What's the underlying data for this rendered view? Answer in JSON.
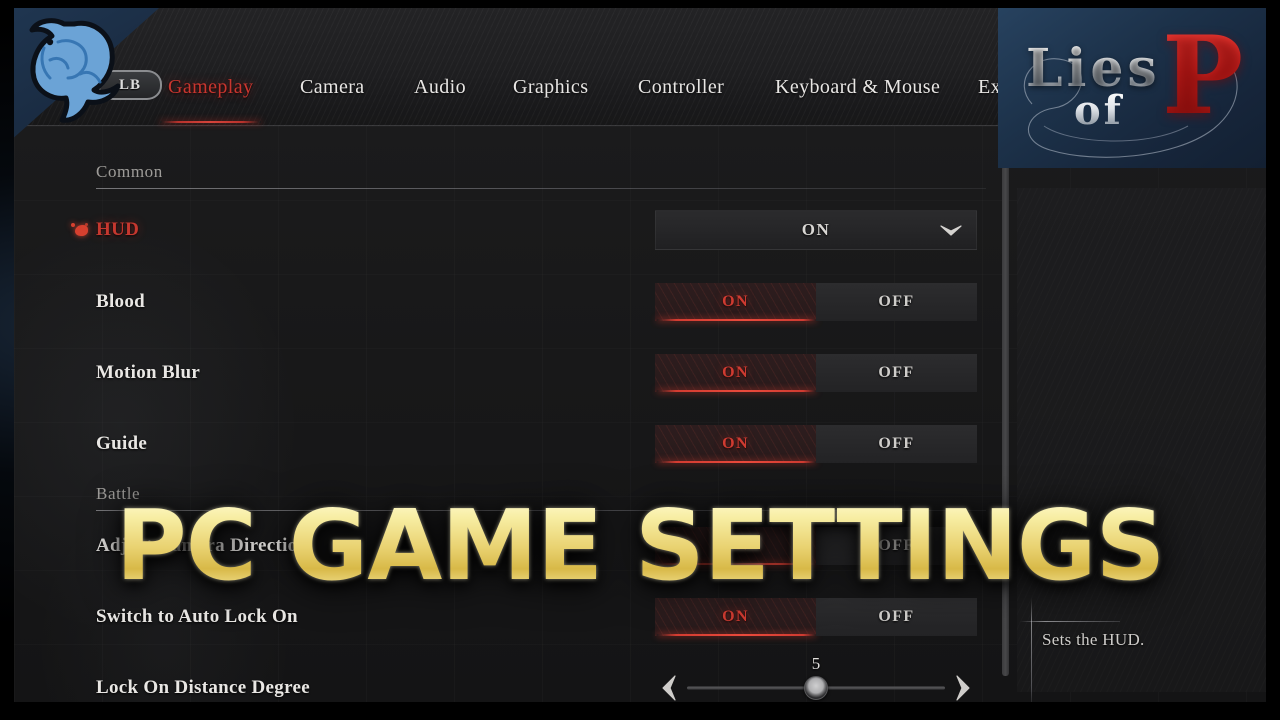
{
  "overlay": {
    "title": "PC GAME SETTINGS",
    "channel_logo": "blue-creature-mascot-logo"
  },
  "game_logo": {
    "line1": "Lies",
    "line2": "of",
    "accent": "P",
    "accent_color": "#d2241e"
  },
  "nav": {
    "bumper_label": "LB",
    "tabs": [
      {
        "label": "Gameplay",
        "active": true
      },
      {
        "label": "Camera",
        "active": false
      },
      {
        "label": "Audio",
        "active": false
      },
      {
        "label": "Graphics",
        "active": false
      },
      {
        "label": "Controller",
        "active": false
      },
      {
        "label": "Keyboard & Mouse",
        "active": false
      },
      {
        "label": "Exit",
        "active": false
      }
    ]
  },
  "sections": [
    {
      "title": "Common"
    },
    {
      "title": "Battle"
    }
  ],
  "rows": [
    {
      "label": "HUD",
      "control": "dropdown",
      "value": "ON",
      "selected": true
    },
    {
      "label": "Blood",
      "control": "toggle",
      "value": "ON",
      "options": [
        "ON",
        "OFF"
      ],
      "selected": false
    },
    {
      "label": "Motion Blur",
      "control": "toggle",
      "value": "ON",
      "options": [
        "ON",
        "OFF"
      ],
      "selected": false
    },
    {
      "label": "Guide",
      "control": "toggle",
      "value": "ON",
      "options": [
        "ON",
        "OFF"
      ],
      "selected": false
    },
    {
      "label": "Adjust Camera Direction",
      "control": "toggle",
      "value": "ON",
      "options": [
        "ON",
        "OFF"
      ],
      "selected": false
    },
    {
      "label": "Switch to Auto Lock On",
      "control": "toggle",
      "value": "ON",
      "options": [
        "ON",
        "OFF"
      ],
      "selected": false
    },
    {
      "label": "Lock On Distance Degree",
      "control": "slider",
      "value": "5",
      "selected": false
    }
  ],
  "description": {
    "text": "Sets the HUD."
  },
  "colors": {
    "accent_red": "#c9362f",
    "toggle_on_red": "#cf3b31",
    "text_primary": "#e9e7e4",
    "text_muted": "#9e9c99",
    "title_gold": "#e9d271",
    "frame_blue": "#16253c"
  }
}
